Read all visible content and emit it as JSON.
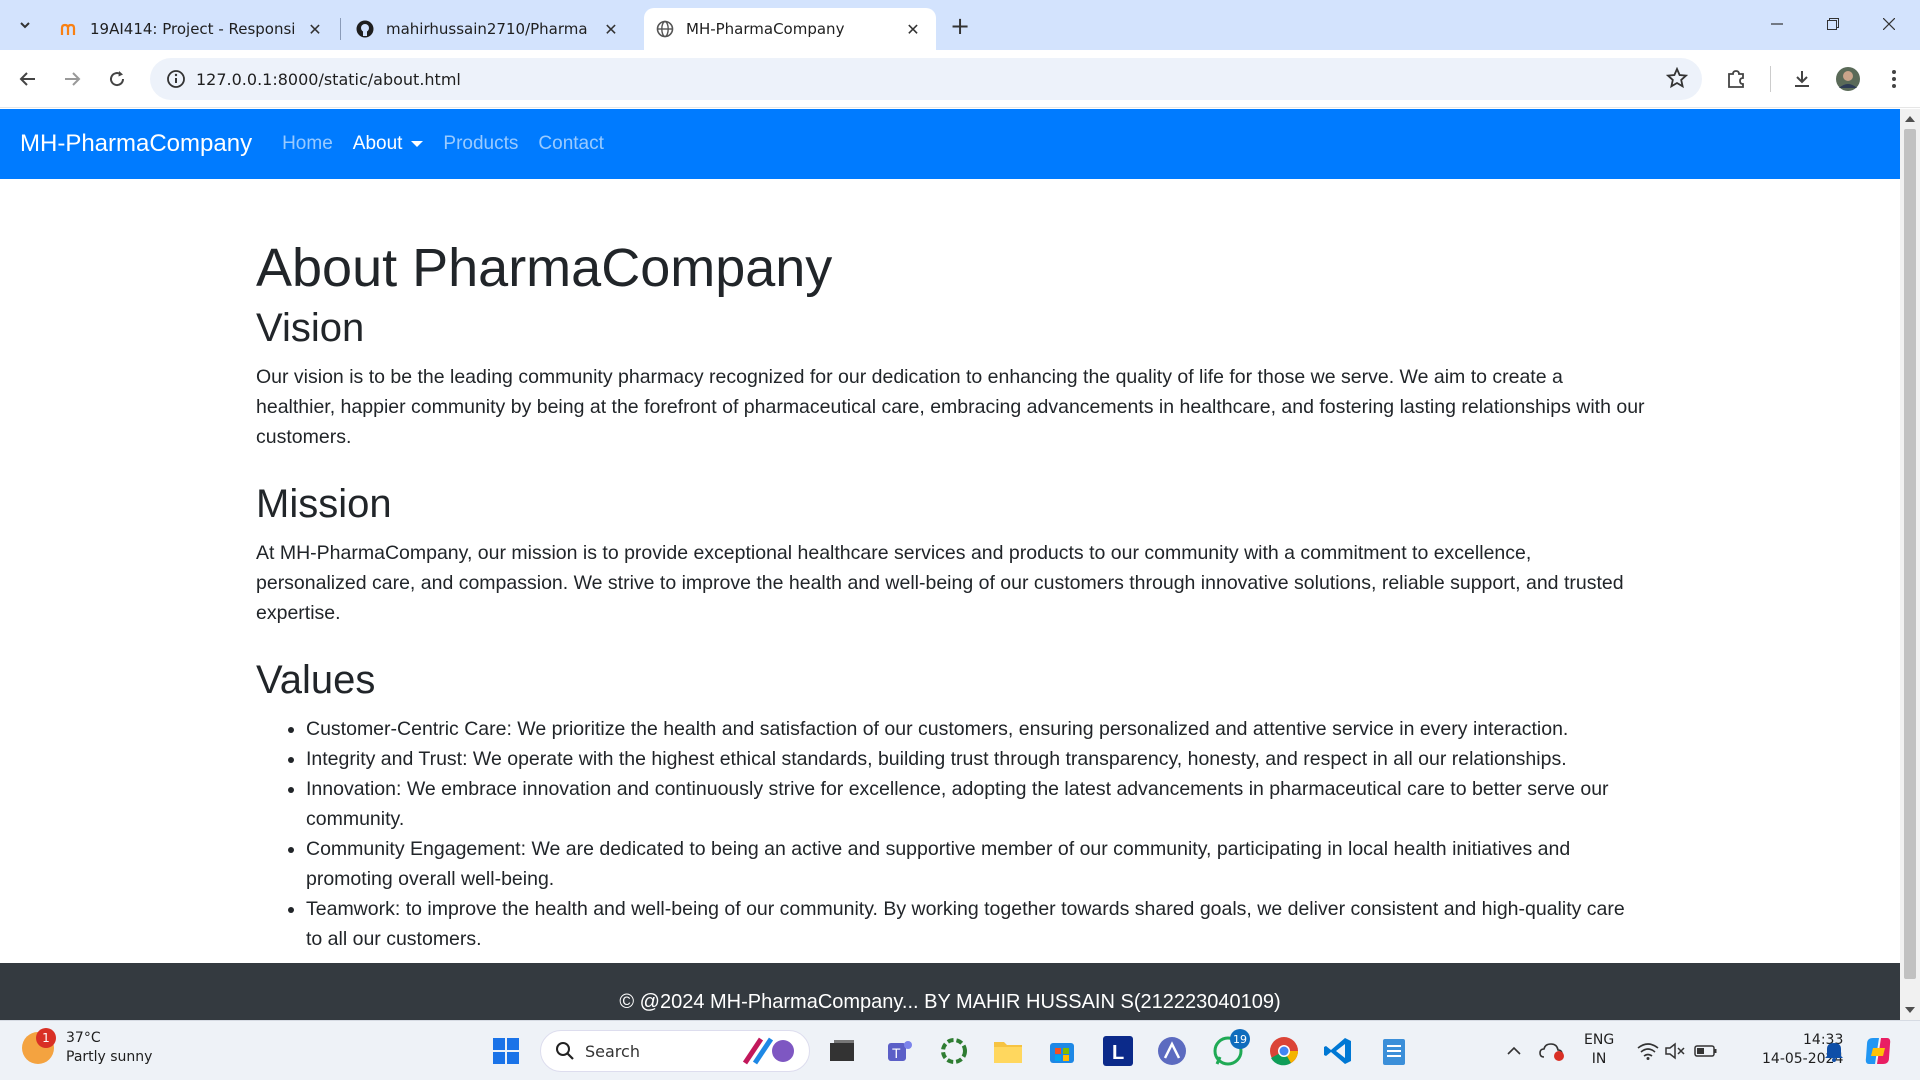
{
  "browser": {
    "tabs": [
      {
        "title": "19AI414: Project - Responsive W",
        "favicon": "moodle-icon"
      },
      {
        "title": "mahirhussain2710/Pharma",
        "favicon": "github-icon"
      },
      {
        "title": "MH-PharmaCompany",
        "favicon": "globe-icon"
      }
    ],
    "url": "127.0.0.1:8000/static/about.html"
  },
  "page": {
    "brand": "MH-PharmaCompany",
    "nav": [
      {
        "label": "Home"
      },
      {
        "label": "About"
      },
      {
        "label": "Products"
      },
      {
        "label": "Contact"
      }
    ],
    "heading": "About PharmaCompany",
    "vision_title": "Vision",
    "vision_text": "Our vision is to be the leading community pharmacy recognized for our dedication to enhancing the quality of life for those we serve. We aim to create a healthier, happier community by being at the forefront of pharmaceutical care, embracing advancements in healthcare, and fostering lasting relationships with our customers.",
    "mission_title": "Mission",
    "mission_text": "At MH-PharmaCompany, our mission is to provide exceptional healthcare services and products to our community with a commitment to excellence, personalized care, and compassion. We strive to improve the health and well-being of our customers through innovative solutions, reliable support, and trusted expertise.",
    "values_title": "Values",
    "values": [
      "Customer-Centric Care: We prioritize the health and satisfaction of our customers, ensuring personalized and attentive service in every interaction.",
      "Integrity and Trust: We operate with the highest ethical standards, building trust through transparency, honesty, and respect in all our relationships.",
      "Innovation: We embrace innovation and continuously strive for excellence, adopting the latest advancements in pharmaceutical care to better serve our community.",
      "Community Engagement: We are dedicated to being an active and supportive member of our community, participating in local health initiatives and promoting overall well-being.",
      "Teamwork: to improve the health and well-being of our community. By working together towards shared goals, we deliver consistent and high-quality care to all our customers."
    ],
    "footer": "© @2024 MH-PharmaCompany... BY MAHIR HUSSAIN S(212223040109)"
  },
  "taskbar": {
    "weather_temp": "37°C",
    "weather_desc": "Partly sunny",
    "weather_badge": "1",
    "search_label": "Search",
    "whatsapp_badge": "19",
    "lang_top": "ENG",
    "lang_bottom": "IN",
    "time": "14:33",
    "date": "14-05-2024"
  },
  "colors": {
    "navbar": "#007bff",
    "footer": "#343a40",
    "tabstrip": "#d3e3fd"
  }
}
